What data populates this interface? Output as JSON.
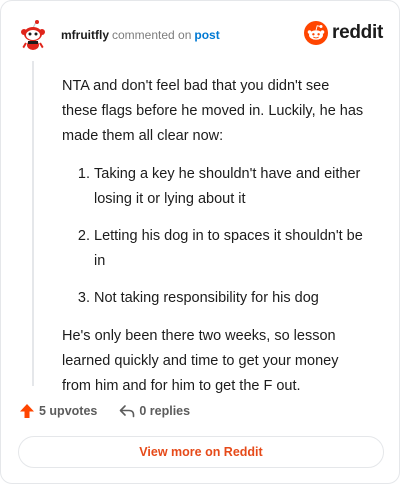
{
  "header": {
    "username": "mfruitfly",
    "action_text": "commented on",
    "target_text": "post",
    "brand_name": "reddit"
  },
  "comment": {
    "intro": "NTA and don't feel bad that you didn't see these flags before he moved in. Luckily, he has made them all clear now:",
    "items": [
      "Taking a key he shouldn't have and either losing it or lying about it",
      "Letting his dog in to spaces it shouldn't be in",
      "Not taking responsibility for his dog"
    ],
    "outro": "He's only been there two weeks, so lesson learned quickly and time to get your money from him and for him to get the F out."
  },
  "footer": {
    "upvotes_label": "5 upvotes",
    "replies_label": "0 replies"
  },
  "view_button_label": "View more on Reddit",
  "colors": {
    "brand_orange": "#ff4500",
    "link_blue": "#0079d3",
    "button_text": "#e64a19"
  },
  "icons": {
    "avatar": "snoo-avatar-icon",
    "brand": "reddit-logo-icon",
    "upvote": "upvote-arrow-icon",
    "reply": "reply-arrow-icon"
  }
}
